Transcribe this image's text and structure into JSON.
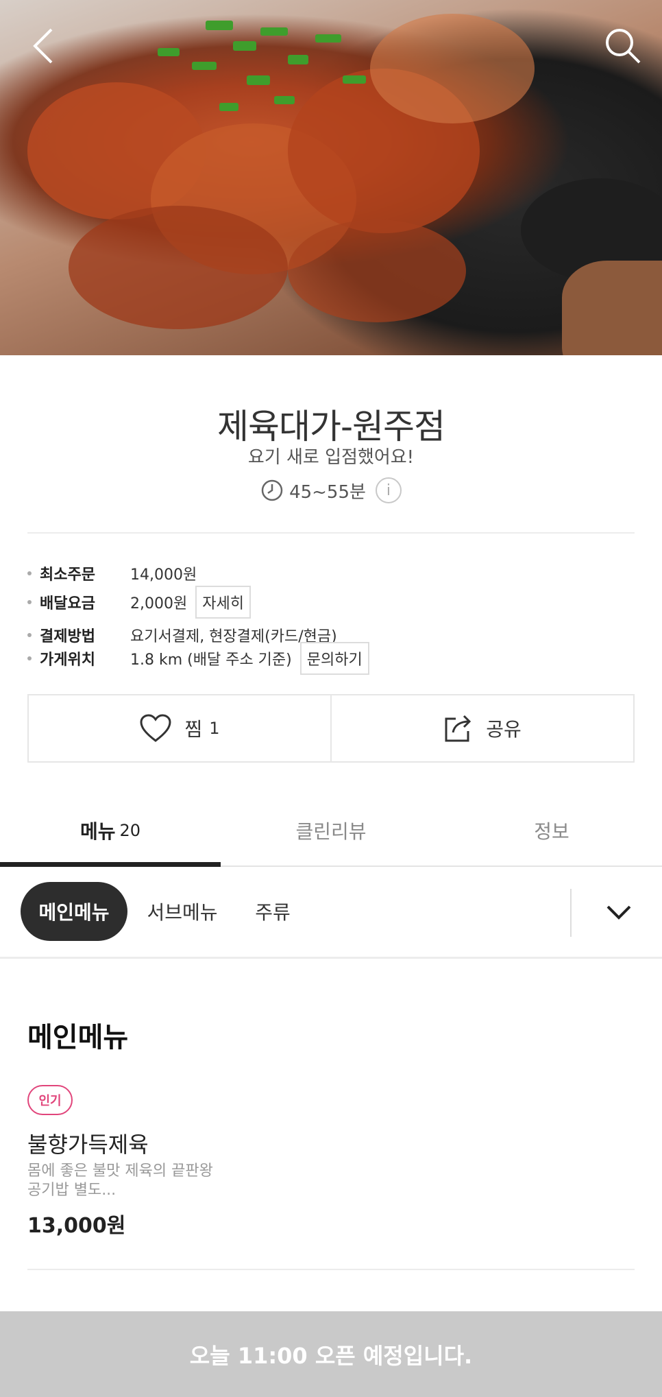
{
  "header": {
    "back_icon": "chevron-left-icon",
    "search_icon": "search-icon"
  },
  "store": {
    "name": "제육대가-원주점",
    "subtitle": "요기 새로 입점했어요!",
    "delivery_time": "45~55분",
    "info_icon": "i"
  },
  "info": {
    "min_order_label": "최소주문",
    "min_order_value": "14,000원",
    "delivery_fee_label": "배달요금",
    "delivery_fee_value": "2,000원",
    "delivery_fee_button": "자세히",
    "payment_label": "결제방법",
    "payment_value": "요기서결제, 현장결제(카드/현금)",
    "location_label": "가게위치",
    "location_value": "1.8 km (배달 주소 기준)",
    "location_button": "문의하기"
  },
  "actions": {
    "like_label": "찜",
    "like_count": "1",
    "share_label": "공유"
  },
  "tabs": [
    {
      "label": "메뉴",
      "count": "20",
      "active": true
    },
    {
      "label": "클린리뷰",
      "count": "",
      "active": false
    },
    {
      "label": "정보",
      "count": "",
      "active": false
    }
  ],
  "categories": [
    {
      "label": "메인메뉴",
      "active": true
    },
    {
      "label": "서브메뉴",
      "active": false
    },
    {
      "label": "주류",
      "active": false
    }
  ],
  "menu_section": {
    "title": "메인메뉴",
    "items": [
      {
        "badge": "인기",
        "name": "불향가득제육",
        "description_line1": "몸에 좋은 불맛 제육의 끝판왕",
        "description_line2": "공기밥 별도...",
        "price": "13,000원"
      }
    ]
  },
  "bottom_bar": {
    "message": "오늘 11:00 오픈 예정입니다."
  },
  "colors": {
    "badge": "#e1457b",
    "bottom_bar": "#c9c9c9",
    "active_chip": "#2d2d2d"
  }
}
